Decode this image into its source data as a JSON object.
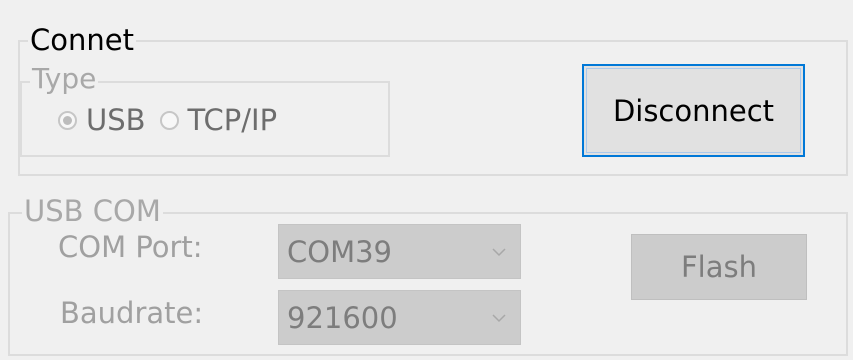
{
  "connet": {
    "title": "Connet",
    "type_group": {
      "title": "Type",
      "options": [
        {
          "label": "USB",
          "checked": true
        },
        {
          "label": "TCP/IP",
          "checked": false
        }
      ]
    },
    "disconnect_label": "Disconnect"
  },
  "usb_com": {
    "title": "USB COM",
    "com_port_label": "COM Port:",
    "com_port_value": "COM39",
    "baudrate_label": "Baudrate:",
    "baudrate_value": "921600",
    "flash_label": "Flash"
  },
  "icons": {
    "dropdown": "chevron-down-icon"
  },
  "colors": {
    "focus_border": "#0078d7",
    "disabled_text": "#a0a0a0",
    "background": "#f0f0f0"
  }
}
